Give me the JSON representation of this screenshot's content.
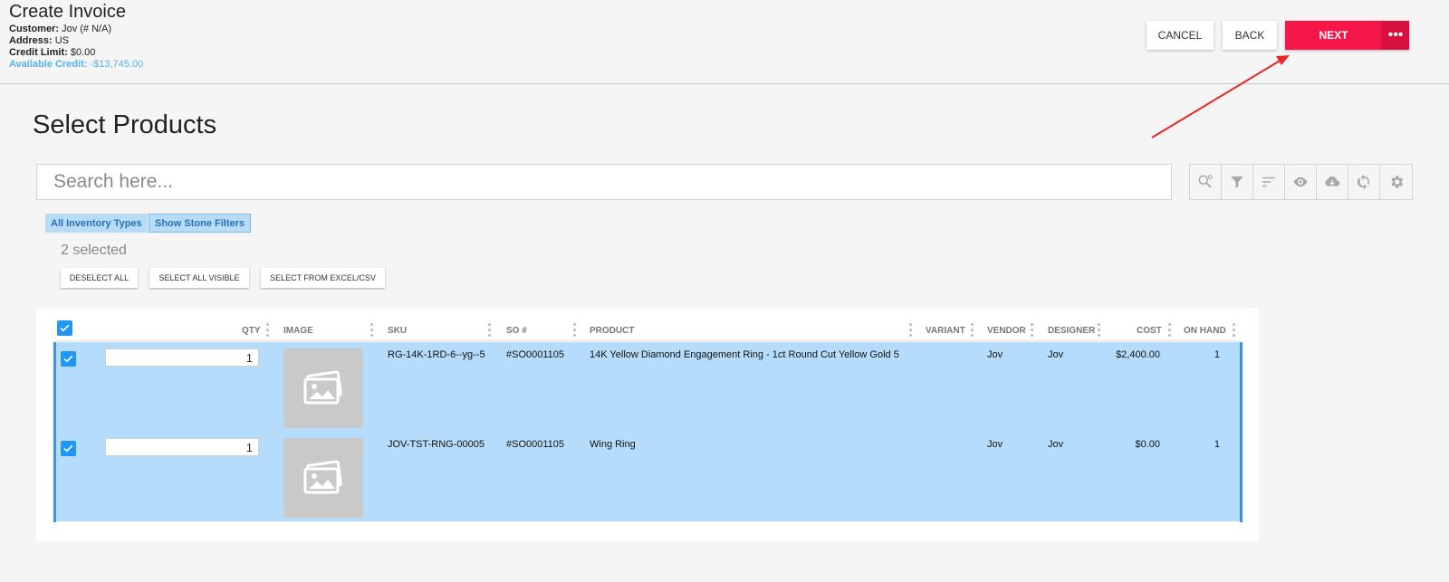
{
  "header": {
    "title": "Create Invoice",
    "customer_label": "Customer:",
    "customer_value": "Jov (# N/A)",
    "address_label": "Address:",
    "address_value": "US",
    "credit_limit_label": "Credit Limit:",
    "credit_limit_value": "$0.00",
    "available_credit_label": "Available Credit:",
    "available_credit_value": "-$13,745.00",
    "buttons": {
      "cancel": "CANCEL",
      "back": "BACK",
      "next": "NEXT",
      "more": "•••"
    }
  },
  "page": {
    "section_title": "Select Products",
    "search_placeholder": "Search here...",
    "toolbar_icons": [
      "search-settings-icon",
      "filter-icon",
      "sort-icon",
      "eye-icon",
      "cloud-download-icon",
      "refresh-icon",
      "gear-icon"
    ],
    "chips": {
      "inventory_types": "All Inventory Types",
      "stone_filters": "Show Stone Filters"
    },
    "selected_count": "2 selected",
    "actions": {
      "deselect_all": "DESELECT ALL",
      "select_all_visible": "SELECT ALL VISIBLE",
      "select_from_excel": "SELECT FROM EXCEL/CSV"
    }
  },
  "table": {
    "columns": {
      "qty": "QTY",
      "image": "IMAGE",
      "sku": "SKU",
      "so": "SO #",
      "product": "PRODUCT",
      "variant": "VARIANT",
      "vendor": "VENDOR",
      "designer": "DESIGNER",
      "cost": "COST",
      "on_hand": "ON HAND"
    },
    "rows": [
      {
        "checked": true,
        "qty": "1",
        "sku": "RG-14K-1RD-6--yg--5",
        "so": "#SO0001105",
        "product": "14K Yellow Diamond Engagement Ring - 1ct Round Cut Yellow Gold 5",
        "variant": "",
        "vendor": "Jov",
        "designer": "Jov",
        "cost": "$2,400.00",
        "on_hand": "1"
      },
      {
        "checked": true,
        "qty": "1",
        "sku": "JOV-TST-RNG-00005",
        "so": "#SO0001105",
        "product": "Wing Ring",
        "variant": "",
        "vendor": "Jov",
        "designer": "Jov",
        "cost": "$0.00",
        "on_hand": "1"
      }
    ]
  },
  "colors": {
    "accent": "#f5174a",
    "row_selected": "#b5dcfa",
    "checkbox": "#2196f3",
    "credit_text": "#5ab0ea"
  }
}
